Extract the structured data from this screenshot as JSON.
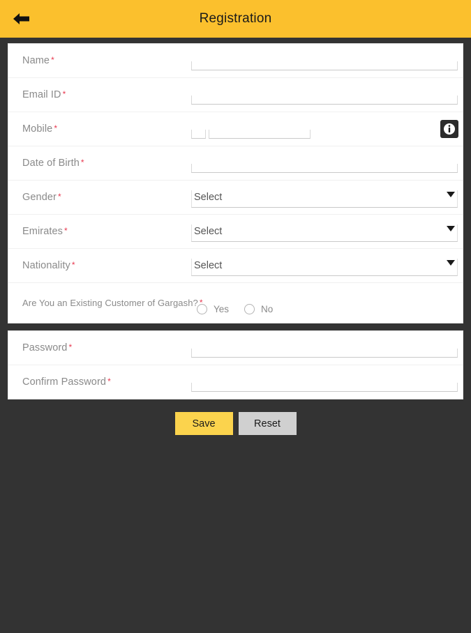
{
  "header": {
    "title": "Registration",
    "back_icon": "back-arrow-icon"
  },
  "form": {
    "required_mark": "*",
    "fields": [
      {
        "label": "Name",
        "type": "text",
        "value": "",
        "placeholder": ""
      },
      {
        "label": "Email ID",
        "type": "text",
        "value": "",
        "placeholder": ""
      },
      {
        "label": "Mobile",
        "type": "phone",
        "code_value": "",
        "code_placeholder": "",
        "value": "",
        "placeholder": "",
        "info_icon": "info-icon"
      },
      {
        "label": "Date of Birth",
        "type": "text",
        "value": "",
        "placeholder": ""
      },
      {
        "label": "Gender",
        "type": "select",
        "value": "Select"
      },
      {
        "label": "Emirates",
        "type": "select",
        "value": "Select"
      },
      {
        "label": "Nationality",
        "type": "select",
        "value": "Select"
      },
      {
        "label": "Are You an Existing Customer of Gargash?",
        "type": "radio",
        "options": [
          {
            "label": "Yes",
            "selected": false
          },
          {
            "label": "No",
            "selected": false
          }
        ]
      }
    ],
    "password_fields": [
      {
        "label": "Password",
        "type": "password",
        "value": "",
        "placeholder": ""
      },
      {
        "label": "Confirm Password",
        "type": "password",
        "value": "",
        "placeholder": ""
      }
    ]
  },
  "actions": {
    "save_label": "Save",
    "reset_label": "Reset"
  },
  "colors": {
    "header_bg": "#fbc02d",
    "page_bg": "#333333",
    "card_bg": "#ffffff",
    "label": "#8a8a8a",
    "required": "#e8384f",
    "save_bg": "#fbd34d",
    "reset_bg": "#d0d0d0",
    "info_bg": "#2b2b2b"
  }
}
